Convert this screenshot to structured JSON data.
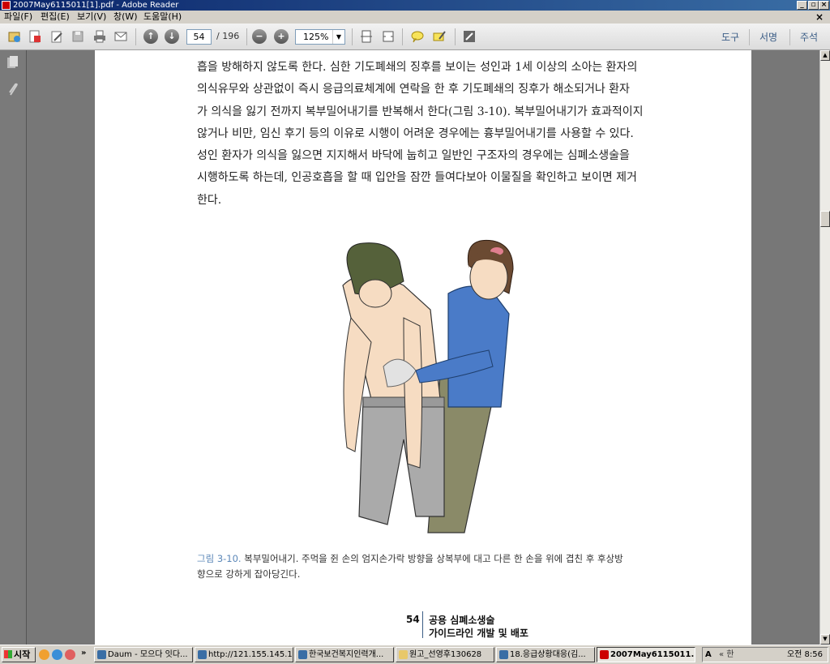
{
  "window": {
    "title": "2007May6115011[1].pdf - Adobe Reader",
    "min_icon": "minimize-icon",
    "max_icon": "restore-icon",
    "close_icon": "close-icon"
  },
  "menubar": {
    "items": [
      "파일(F)",
      "편집(E)",
      "보기(V)",
      "창(W)",
      "도움말(H)"
    ],
    "doc_close": "×"
  },
  "toolbar": {
    "current_page": "54",
    "total_pages": "/ 196",
    "zoom": "125%",
    "right_tabs": [
      "도구",
      "서명",
      "주석"
    ]
  },
  "document": {
    "paragraph": [
      "흡을 방해하지 않도록 한다. 심한 기도폐쇄의 징후를 보이는 성인과 1세 이상의 소아는 환자의",
      "의식유무와 상관없이 즉시 응급의료체계에 연락을 한 후 기도폐쇄의 징후가 해소되거나 환자",
      "가 의식을 잃기 전까지 복부밀어내기를 반복해서 한다(그림 3-10). 복부밀어내기가 효과적이지",
      "않거나 비만, 임신 후기 등의 이유로 시행이 어려운 경우에는 흉부밀어내기를 사용할 수 있다.",
      "성인 환자가 의식을 잃으면 지지해서 바닥에 눕히고 일반인 구조자의 경우에는 심폐소생술을",
      "시행하도록 하는데, 인공호흡을 할 때 입안을 잠깐 들여다보아 이물질을 확인하고 보이면 제거",
      "한다."
    ],
    "caption_number": "그림 3-10.",
    "caption_line1": " 복부밀어내기. 주먹을 쥔 손의 엄지손가락 방향을 상복부에 대고 다른 한 손을 위에 겹친 후 후상방",
    "caption_line2": "향으로 강하게 잡아당긴다.",
    "page_number": "54",
    "footer_title_1": "공용 심폐소생술",
    "footer_title_2": "가이드라인 개발 및 배포"
  },
  "taskbar": {
    "start": "시작",
    "quick_more": "»",
    "tasks": [
      {
        "label": "Daum - 모으다 잇다...",
        "active": false
      },
      {
        "label": "http://121.155.145.1...",
        "active": false
      },
      {
        "label": "한국보건복지인력개...",
        "active": false
      },
      {
        "label": "원고_선영후130628",
        "active": false
      },
      {
        "label": "18.응급상황대응(김...",
        "active": false
      },
      {
        "label": "2007May6115011...",
        "active": true
      }
    ],
    "tray_ime": "A",
    "tray_icons": "« 한",
    "clock": "오전 8:56"
  },
  "colors": {
    "titlebar_start": "#0a246a",
    "titlebar_end": "#3a6ea5",
    "caption_number": "#5b87b8",
    "shirt": "#4a7bc8",
    "pants_rescuer": "#8a8a68",
    "pants_victim": "#aaaaaa"
  }
}
